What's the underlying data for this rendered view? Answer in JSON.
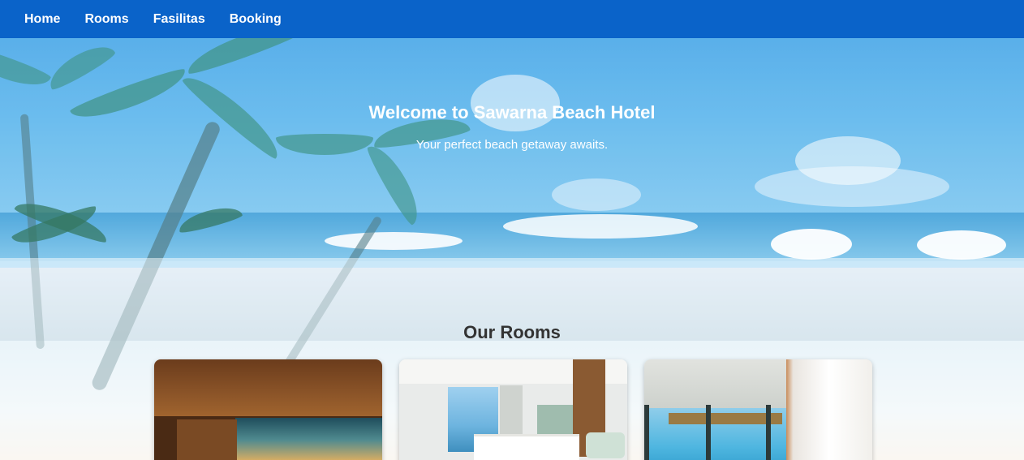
{
  "nav": {
    "items": [
      {
        "label": "Home"
      },
      {
        "label": "Rooms"
      },
      {
        "label": "Fasilitas"
      },
      {
        "label": "Booking"
      }
    ]
  },
  "hero": {
    "title": "Welcome to Sawarna Beach Hotel",
    "subtitle": "Your perfect beach getaway awaits."
  },
  "rooms": {
    "heading": "Our Rooms",
    "cards": [
      {
        "image": "wooden-suite-sunset-view"
      },
      {
        "image": "bright-bedroom-ocean-view"
      },
      {
        "image": "overwater-villa-curtains"
      }
    ]
  },
  "colors": {
    "nav_bg": "#0a63c9",
    "hero_text": "#ffffff",
    "heading_text": "#333333"
  }
}
